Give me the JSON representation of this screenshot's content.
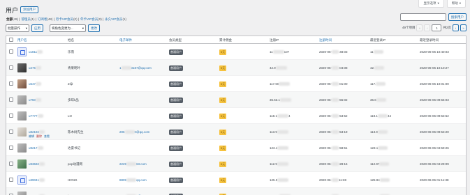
{
  "screen_tabs": {
    "options": "显示选项",
    "help": "帮助"
  },
  "title": "用户",
  "add_new": "添加用户",
  "filters": [
    {
      "label": "全部",
      "count": "(49)",
      "current": true
    },
    {
      "label": "管理员",
      "count": "(1)"
    },
    {
      "label": "订阅者",
      "count": "(48)"
    },
    {
      "label": "月卡VIP会员",
      "count": "(0)"
    },
    {
      "label": "年卡VIP会员",
      "count": "(0)"
    },
    {
      "label": "永久VIP会员",
      "count": "(1)"
    }
  ],
  "search": {
    "placeholder": "",
    "button": "搜索用户"
  },
  "bulk": {
    "select": "批量操作",
    "apply": "应用"
  },
  "role_change": {
    "select": "将角色变更为...",
    "button": "更改"
  },
  "pagination": {
    "count": "49个项目",
    "current": "1",
    "of": "共2页",
    "first": "«",
    "prev": "‹",
    "next": "›",
    "last": "»"
  },
  "columns": {
    "username": "用户名",
    "name": "姓名",
    "email": "电子邮件",
    "member_type": "会员类型",
    "commission": "累计佣金",
    "reg_ip": "注册IP",
    "reg_time": "注册时间",
    "last_ip": "最近登录IP",
    "last_time": "最近登录时间"
  },
  "colors": {
    "link": "#2271b1",
    "badge_user": "#555d66",
    "badge_vip": "#f6c23e"
  },
  "rows": [
    {
      "user": "u1811",
      "name": "乐而",
      "email": "",
      "type": "普通用户",
      "vip": "0元",
      "reg_ip": "11",
      "reg_ip2": "107",
      "reg_time": "2020-06-",
      "reg_time2": ":48:03",
      "last_ip": "11",
      "last_time": "2020-06-06 10:40:03",
      "avatar": "blue"
    },
    {
      "user": "u475",
      "name": "青果明叶",
      "email": "1",
      "email2": "3187@qq.com",
      "type": "普通用户",
      "vip": "0元",
      "reg_ip": "42.9",
      "reg_ip2": "",
      "reg_time": "2020-06-",
      "reg_time2": ":04:08",
      "last_ip": "42.",
      "last_time": "2020-06-06 10:10:27",
      "avatar": "dark"
    },
    {
      "user": "u547",
      "name": "Z😀",
      "email": "",
      "type": "普通用户",
      "vip": "0元",
      "reg_ip": "117.60",
      "reg_ip2": "",
      "reg_time": "2020-06-",
      "reg_time2": ":01:00",
      "last_ip": "117.",
      "last_time": "2020-06-06 10:01:00",
      "avatar": "warm"
    },
    {
      "user": "u750",
      "name": "多味k品",
      "email": "",
      "type": "普通用户",
      "vip": "0元",
      "reg_ip": "36.63.1",
      "reg_ip2": "",
      "reg_time": "2020-06-",
      "reg_time2": ":55:02",
      "last_ip": "36.6",
      "last_time": "2020-06-06 09:55:03",
      "avatar": "gray"
    },
    {
      "user": "u7777",
      "name": "LO",
      "email": "",
      "type": "普通用户",
      "vip": "0元",
      "reg_ip": "118.1",
      "reg_ip2": "4",
      "reg_time": "2020-06-",
      "reg_time2": ":53:52",
      "last_ip": "118.1",
      "last_ip2": "44",
      "last_time": "2020-06-06 09:53:52",
      "avatar": "gray"
    },
    {
      "user": "u82192",
      "name": "陈木树先生",
      "email": "206",
      "email2": "0@qq.com",
      "type": "普通用户",
      "vip": "0元",
      "reg_ip": "113.9",
      "reg_ip2": "",
      "reg_time": "2020-06-",
      "reg_time2": ":53:19",
      "last_ip": "113.9",
      "last_time": "2020-06-06 09:53:20",
      "avatar": "pale",
      "actions": [
        "编辑",
        "删除",
        "查看"
      ]
    },
    {
      "user": "u9217",
      "name": "达豪书记",
      "email": "",
      "type": "普通用户",
      "vip": "0元",
      "reg_ip": "123.1",
      "reg_ip2": "",
      "reg_time": "2020-06-",
      "reg_time2": ":58:51",
      "last_ip": "123.1",
      "last_time": "2020-06-06 04:59:26",
      "avatar": "gray"
    },
    {
      "user": "u93632",
      "name": "pop动漫网",
      "email": "2229",
      "email2": "63.com",
      "type": "普通用户",
      "vip": "0元",
      "reg_ip": "112.9",
      "reg_ip2": "",
      "reg_time": "2020-06-",
      "reg_time2": ":28:16",
      "last_ip": "112.97",
      "last_time": "2020-06-06 04:29:09",
      "avatar": "green"
    },
    {
      "user": "u39041",
      "name": "HONG",
      "email": "8809",
      "email2": "qq.com",
      "type": "普通用户",
      "vip": "0元",
      "reg_ip": "125.9",
      "reg_ip2": "",
      "reg_time": "2020-06-",
      "reg_time2": "11:38",
      "last_ip": "125.94",
      "last_time": "2020-06-06 01:11:38",
      "avatar": "blue"
    },
    {
      "user": "u49966",
      "name": "jamo",
      "email": "9223",
      "email2": "0@qq.com",
      "type": "普通用户",
      "vip": "0元",
      "reg_ip": "125.10",
      "reg_ip2": "",
      "reg_time": "2020-06-",
      "reg_time2": "05:13",
      "last_ip": "125.10",
      "last_time": "2020-06-06 00:05:13",
      "avatar": "gray"
    }
  ]
}
